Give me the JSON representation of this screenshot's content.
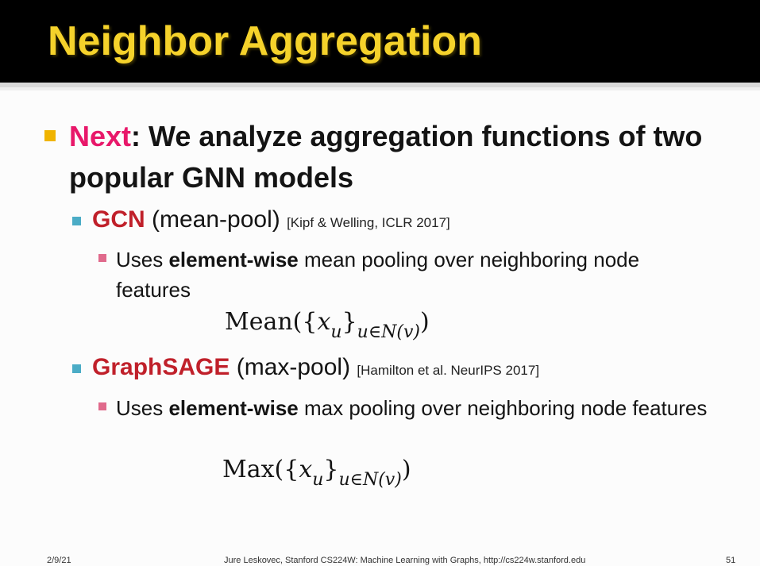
{
  "slide": {
    "title": "Neighbor Aggregation",
    "bullet_main": {
      "lead": "Next",
      "sep": ": ",
      "text": "We analyze aggregation functions of two popular GNN models"
    },
    "items": [
      {
        "model": "GCN",
        "pool": " (mean-pool) ",
        "citation": "[Kipf & Welling, ICLR 2017]",
        "detail_pre": "Uses ",
        "detail_bold": "element-wise",
        "detail_post": " mean pooling over neighboring node features",
        "formula": {
          "fn": "Mean(",
          "open": "{",
          "var": "x",
          "var_sub": "u",
          "close": "}",
          "sub": "u∈N(v)",
          "end": ")"
        }
      },
      {
        "model": "GraphSAGE",
        "pool": " (max-pool) ",
        "citation": "[Hamilton et al. NeurIPS 2017]",
        "detail_pre": "Uses ",
        "detail_bold": "element-wise",
        "detail_post": " max pooling over neighboring node features",
        "formula": {
          "fn": "Max(",
          "open": "{",
          "var": "x",
          "var_sub": "u",
          "close": "}",
          "sub": "u∈N(v)",
          "end": ")"
        }
      }
    ],
    "footer": {
      "date": "2/9/21",
      "credit": "Jure Leskovec, Stanford CS224W: Machine Learning with Graphs, http://cs224w.stanford.edu",
      "page": "51"
    },
    "colors": {
      "title": "#f5d22b",
      "accent": "#e8186a",
      "model": "#c0202a",
      "l1_bullet": "#f0b400",
      "l2_bullet": "#4bacc6",
      "l3_bullet": "#e06a8c"
    }
  }
}
